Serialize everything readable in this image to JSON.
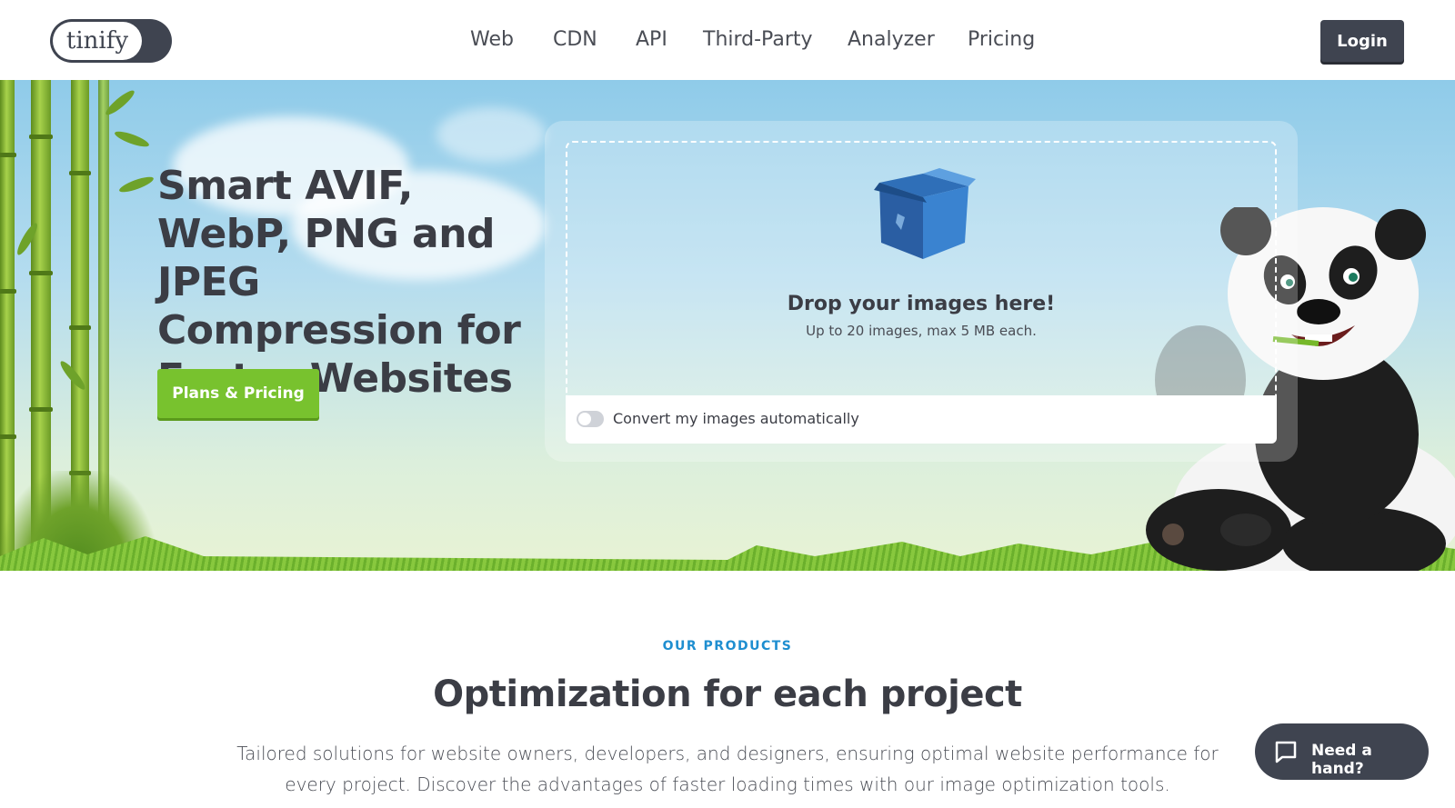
{
  "brand": {
    "logo_text": "tinify"
  },
  "nav": {
    "items": [
      {
        "label": "Web"
      },
      {
        "label": "CDN"
      },
      {
        "label": "API"
      },
      {
        "label": "Third-Party"
      },
      {
        "label": "Analyzer"
      },
      {
        "label": "Pricing"
      }
    ],
    "login_label": "Login"
  },
  "hero": {
    "title": "Smart AVIF, WebP, PNG and JPEG Compression for Faster Websites",
    "cta_label": "Plans & Pricing",
    "dropzone": {
      "title": "Drop your images here!",
      "subtitle": "Up to 20 images, max 5 MB each.",
      "toggle_label": "Convert my images automatically"
    }
  },
  "products": {
    "eyebrow": "OUR PRODUCTS",
    "title": "Optimization for each project",
    "description": "Tailored solutions for website owners, developers, and designers, ensuring optimal website performance for every project. Discover the advantages of faster loading times with our image optimization tools."
  },
  "chat": {
    "label": "Need a hand?"
  },
  "colors": {
    "accent_green": "#78c22e",
    "dark": "#3f4450",
    "eyebrow_blue": "#1e8ed0"
  }
}
